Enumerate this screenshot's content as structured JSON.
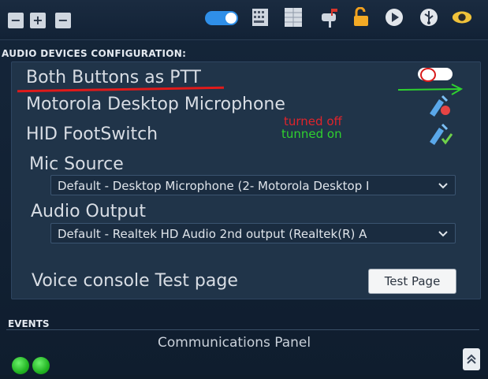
{
  "toolbar": {
    "window_buttons": [
      "−",
      "+",
      "−"
    ],
    "icons": [
      "toggle-switch",
      "keyboard-icon",
      "grid-icon",
      "mailbox-icon",
      "unlock-icon",
      "play-icon",
      "usb-icon",
      "eye-icon"
    ]
  },
  "config": {
    "title": "AUDIO DEVICES CONFIGURATION:",
    "ptt_label": "Both Buttons as PTT",
    "motorola_label": "Motorola Desktop Microphone",
    "hid_label": "HID FootSwitch",
    "mic_source_label": "Mic Source",
    "mic_source_value": "Default - Desktop Microphone (2- Motorola Desktop I",
    "audio_output_label": "Audio Output",
    "audio_output_value": "Default - Realtek HD Audio 2nd output (Realtek(R) A",
    "voice_console_label": "Voice console Test page",
    "test_page_button": "Test Page"
  },
  "annotations": {
    "turned_off": "turned off",
    "turned_on": "tunned on"
  },
  "colors": {
    "annotation_red": "#e0242b",
    "annotation_green": "#2fd12f",
    "toggle_blue": "#2f8fe8"
  },
  "events": {
    "title": "EVENTS",
    "panel_title": "Communications Panel"
  }
}
